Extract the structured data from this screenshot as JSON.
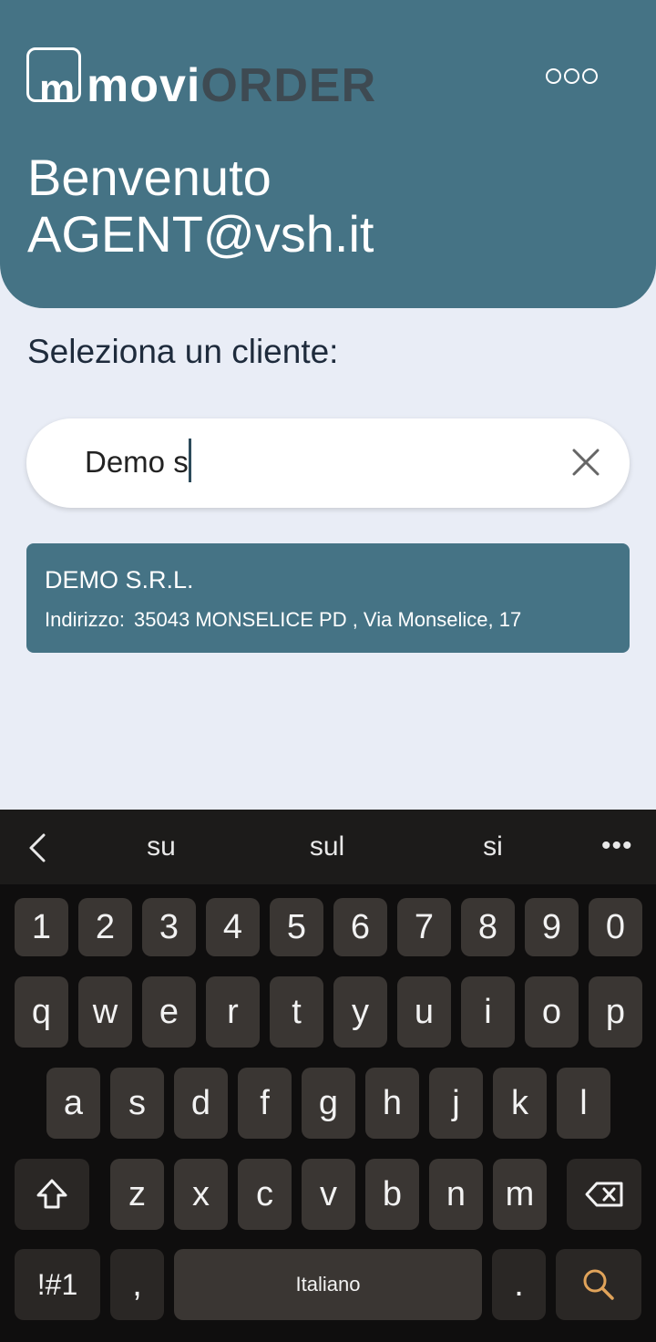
{
  "app": {
    "logo_prefix": "movi",
    "logo_suffix": "ORDER",
    "logo_m": "m",
    "menu_icon": "more-options-icon",
    "welcome_line1": "Benvenuto",
    "welcome_line2": "AGENT@vsh.it"
  },
  "main": {
    "select_label": "Seleziona un cliente:",
    "search_value": "Demo s",
    "clear_icon": "close-icon"
  },
  "results": [
    {
      "name": "DEMO S.R.L.",
      "address_label": "Indirizzo:",
      "address": "35043 MONSELICE PD , Via Monselice, 17"
    }
  ],
  "keyboard": {
    "suggestions": [
      "su",
      "sul",
      "si"
    ],
    "more_label": "•••",
    "numbers": [
      "1",
      "2",
      "3",
      "4",
      "5",
      "6",
      "7",
      "8",
      "9",
      "0"
    ],
    "row1": [
      "q",
      "w",
      "e",
      "r",
      "t",
      "y",
      "u",
      "i",
      "o",
      "p"
    ],
    "row2": [
      "a",
      "s",
      "d",
      "f",
      "g",
      "h",
      "j",
      "k",
      "l"
    ],
    "row3": [
      "z",
      "x",
      "c",
      "v",
      "b",
      "n",
      "m"
    ],
    "symbols_label": "!#1",
    "comma_label": ",",
    "space_label": "Italiano",
    "period_label": ".",
    "search_icon": "search-icon",
    "shift_icon": "shift-icon",
    "backspace_icon": "backspace-icon"
  },
  "colors": {
    "header": "#457385",
    "background": "#e9edf6",
    "logo_dark": "#3e4a52",
    "search_key_icon": "#e0a35a"
  }
}
